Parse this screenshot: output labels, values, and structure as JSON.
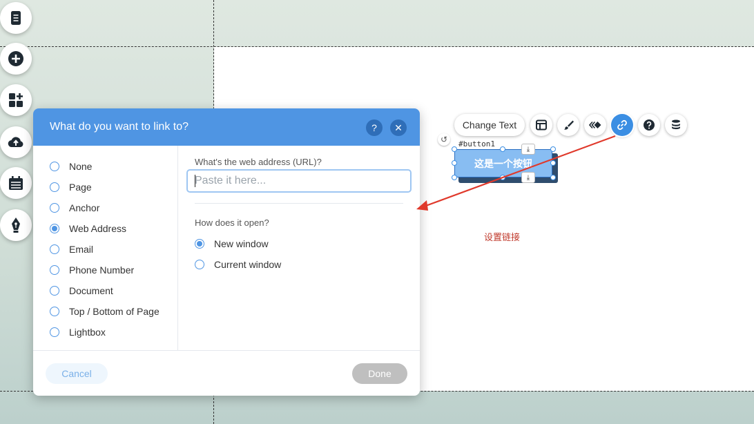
{
  "toolbar_left": {
    "items": [
      {
        "icon": "pages-icon"
      },
      {
        "icon": "add-icon"
      },
      {
        "icon": "apps-icon"
      },
      {
        "icon": "upload-icon"
      },
      {
        "icon": "calendar-icon"
      },
      {
        "icon": "pen-icon"
      }
    ]
  },
  "element_toolbar": {
    "change_text_label": "Change Text",
    "icons": [
      "layout-icon",
      "design-brush-icon",
      "animation-icon",
      "link-icon",
      "help-icon",
      "database-icon"
    ],
    "active_icon": "link-icon",
    "accent_color": "#3b8ee3"
  },
  "selected_element": {
    "id_label": "#button1",
    "text": "这是一个按钮"
  },
  "annotation": {
    "text": "设置链接",
    "color": "#c0392b"
  },
  "dialog": {
    "title": "What do you want to link to?",
    "help_label": "?",
    "close_label": "✕",
    "options": [
      {
        "label": "None",
        "selected": false
      },
      {
        "label": "Page",
        "selected": false
      },
      {
        "label": "Anchor",
        "selected": false
      },
      {
        "label": "Web Address",
        "selected": true
      },
      {
        "label": "Email",
        "selected": false
      },
      {
        "label": "Phone Number",
        "selected": false
      },
      {
        "label": "Document",
        "selected": false
      },
      {
        "label": "Top / Bottom of Page",
        "selected": false
      },
      {
        "label": "Lightbox",
        "selected": false
      }
    ],
    "url_label": "What's the web address (URL)?",
    "url_value": "",
    "url_placeholder": "Paste it here...",
    "open_label": "How does it open?",
    "open_options": [
      {
        "label": "New window",
        "selected": true
      },
      {
        "label": "Current window",
        "selected": false
      }
    ],
    "cancel_label": "Cancel",
    "done_label": "Done",
    "header_color": "#4f95e3"
  }
}
